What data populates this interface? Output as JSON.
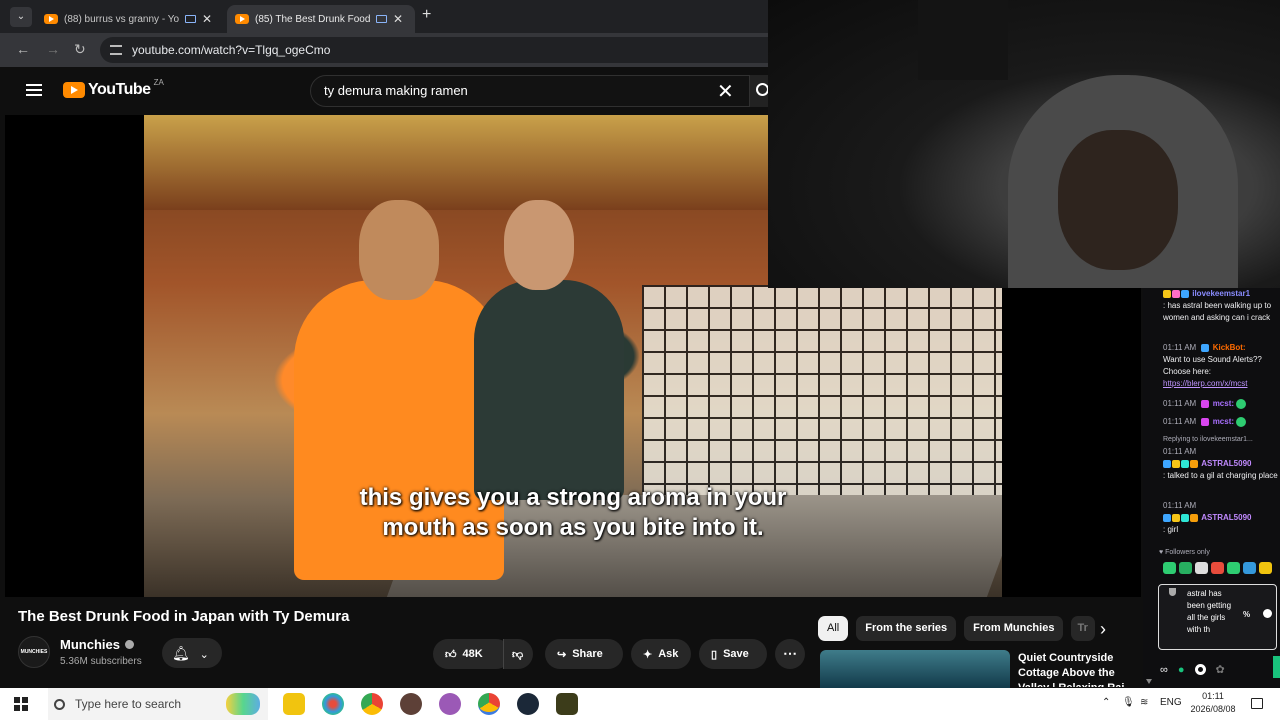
{
  "browser": {
    "tabs": [
      {
        "title": "(88) burrus vs granny - You"
      },
      {
        "title": "(85) The Best Drunk Food in"
      }
    ],
    "url": "youtube.com/watch?v=Tlgq_ogeCmo"
  },
  "youtube": {
    "logo_text": "YouTube",
    "region": "ZA",
    "search_query": "ty demura making ramen"
  },
  "video": {
    "subtitle_line1": "this gives you a strong aroma in your",
    "subtitle_line2": "mouth as soon as you bite into it.",
    "title": "The Best Drunk Food in Japan with Ty Demura",
    "channel": "Munchies",
    "channel_avatar_text": "MUNCHIES",
    "subscribers": "5.36M subscribers",
    "likes": "48K",
    "share_label": "Share",
    "ask_label": "Ask",
    "save_label": "Save"
  },
  "chips": [
    "All",
    "From the series",
    "From Munchies",
    "Tr"
  ],
  "recommendation": {
    "title": "Quiet Countryside Cottage Above the Valley | Relaxing Rai"
  },
  "chat": {
    "messages": [
      {
        "time": "",
        "user": "ilovekeemstar1",
        "text": ": has astral been walking up to women and asking can i crack"
      },
      {
        "time": "01:11 AM",
        "user": "KickBot:",
        "text": "Want to use Sound Alerts?? Choose here:",
        "link": "https://blerp.com/x/mcst"
      },
      {
        "time": "01:11 AM",
        "user": "mcst:"
      },
      {
        "time": "01:11 AM",
        "user": "mcst:"
      },
      {
        "reply": "Replying to ilovekeemstar1...",
        "time": "01:11 AM",
        "user": "ASTRAL5090",
        "text": ": talked to a gil at charging place"
      },
      {
        "time": "01:11 AM",
        "user": "ASTRAL5090",
        "text": ": girl"
      }
    ],
    "followers_only": "Followers only",
    "input_text": "astral has been getting all the girls with th",
    "input_pct": "%"
  },
  "taskbar": {
    "search_placeholder": "Type here to search",
    "language": "ENG",
    "time": "01:11",
    "date": "2026/08/08"
  }
}
